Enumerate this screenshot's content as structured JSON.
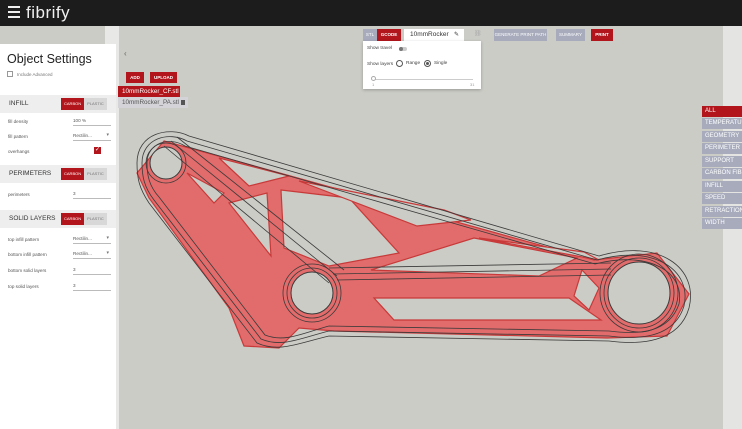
{
  "app": {
    "title": "fibrify"
  },
  "settings": {
    "title": "Object Settings",
    "include_advanced": "Include Advanced",
    "sections": {
      "infill": {
        "label": "INFILL",
        "carbon": "CARBON",
        "plastic": "PLASTIC",
        "rows": [
          {
            "label": "fill density",
            "value": "100 %"
          },
          {
            "label": "fill pattern",
            "value": "Rectilin..."
          },
          {
            "label": "overhangs",
            "value": ""
          }
        ]
      },
      "perimeters": {
        "label": "PERIMETERS",
        "carbon": "CARBON",
        "plastic": "PLASTIC",
        "rows": [
          {
            "label": "perimeters",
            "value": "3"
          }
        ]
      },
      "solid_layers": {
        "label": "SOLID LAYERS",
        "carbon": "CARBON",
        "plastic": "PLASTIC",
        "rows": [
          {
            "label": "top infill pattern",
            "value": "Rectilin..."
          },
          {
            "label": "bottom infill pattern",
            "value": "Rectilin..."
          },
          {
            "label": "bottom solid layers",
            "value": "3"
          },
          {
            "label": "top solid layers",
            "value": "3"
          }
        ]
      }
    }
  },
  "files": {
    "add": "ADD",
    "upload": "UPLOAD",
    "items": [
      "10mmRocker_CF.stl",
      "10mmRocker_PA.stl"
    ]
  },
  "toolbar": {
    "stl": "STL",
    "gcode": "GCODE",
    "object_name": "10mmRocker",
    "generate": "GENERATE PRINT PATH",
    "summary": "SUMMARY",
    "print": "PRINT"
  },
  "view": {
    "show_travel": "Show travel",
    "show_layers": "Show layers",
    "range": "Range",
    "single": "Single",
    "slider_min": "1",
    "slider_max": "31"
  },
  "filters": [
    "ALL",
    "TEMPERATURE",
    "GEOMETRY",
    "PERIMETER",
    "SUPPORT",
    "CARBON FIBER",
    "INFILL",
    "SPEED",
    "RETRACTION",
    "WIDTH"
  ],
  "colors": {
    "accent": "#b3151c",
    "canvas": "#cbccc6",
    "part_fill": "#e26b6b",
    "contour": "#3a3a3a"
  }
}
